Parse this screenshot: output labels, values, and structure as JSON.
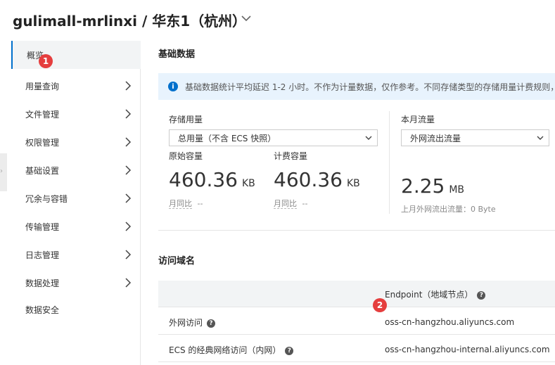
{
  "header": {
    "title": "gulimall-mrlinxi / 华东1（杭州）"
  },
  "sidebar": {
    "items": [
      {
        "label": "概览"
      },
      {
        "label": "用量查询"
      },
      {
        "label": "文件管理"
      },
      {
        "label": "权限管理"
      },
      {
        "label": "基础设置"
      },
      {
        "label": "冗余与容错"
      },
      {
        "label": "传输管理"
      },
      {
        "label": "日志管理"
      },
      {
        "label": "数据处理"
      },
      {
        "label": "数据安全"
      }
    ]
  },
  "badges": {
    "one": "1",
    "two": "2"
  },
  "basic": {
    "title": "基础数据",
    "notice": "基础数据统计平均延迟 1-2 小时。不作为计量数据，仅作参考。不同存储类型的存储用量计费规则，",
    "storage": {
      "label": "存储用量",
      "select": "总用量（不含 ECS 快照）",
      "raw_label": "原始容量",
      "raw_value": "460.36",
      "raw_unit": "KB",
      "raw_compare": "月同比",
      "raw_compare_value": "--",
      "billed_label": "计费容量",
      "billed_value": "460.36",
      "billed_unit": "KB",
      "billed_compare": "月同比",
      "billed_compare_value": "--"
    },
    "traffic": {
      "label": "本月流量",
      "select": "外网流出流量",
      "value": "2.25",
      "unit": "MB",
      "last_month": "上月外网流出流量：0 Byte"
    }
  },
  "domains": {
    "title": "访问域名",
    "col_endpoint": "Endpoint（地域节点）",
    "rows": [
      {
        "label": "外网访问",
        "endpoint": "oss-cn-hangzhou.aliyuncs.com"
      },
      {
        "label": "ECS 的经典网络访问（内网）",
        "endpoint": "oss-cn-hangzhou-internal.aliyuncs.com"
      }
    ]
  },
  "colors": {
    "accent": "#0070cc",
    "badge": "#e53e3e",
    "notice_bg": "#e8f3fd"
  },
  "icons": [
    "chevron-down-icon",
    "chevron-right-icon",
    "info-icon",
    "help-icon"
  ]
}
